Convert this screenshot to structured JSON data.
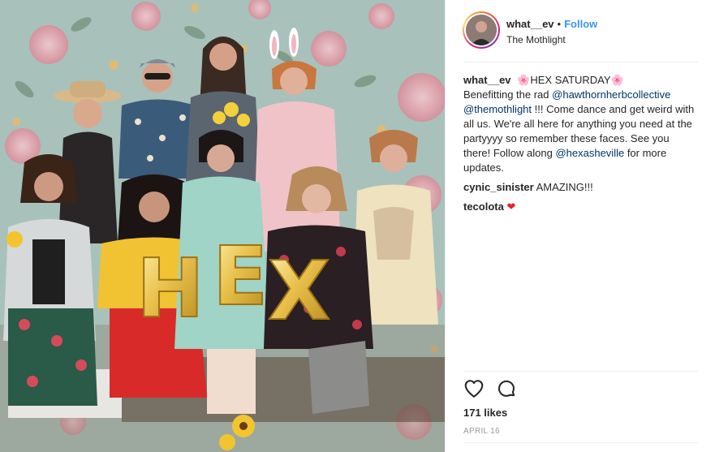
{
  "post": {
    "username": "what__ev",
    "follow_label": "Follow",
    "separator": "•",
    "location": "The Mothlight",
    "photo_balloon_letters": [
      "H",
      "E",
      "X"
    ],
    "caption": {
      "username": "what__ev",
      "flower_emoji": "🌸",
      "title": "HEX SATURDAY",
      "text_1": "Benefitting the rad ",
      "mention_1": "@hawthornherbcollective",
      "mention_2": "@themothlight",
      "text_2": " !!! Come dance and get weird with all us. We're all here for anything you need at the partyyyy so remember these faces. See you there! Follow along ",
      "mention_3": "@hexasheville",
      "text_3": " for more updates."
    },
    "comments": [
      {
        "username": "cynic_sinister",
        "text": "AMAZING!!!"
      },
      {
        "username": "tecolota",
        "text": "❤"
      }
    ],
    "likes": "171 likes",
    "date": "APRIL 16",
    "icons": {
      "like": "heart-outline-icon",
      "comment": "comment-bubble-icon"
    }
  }
}
